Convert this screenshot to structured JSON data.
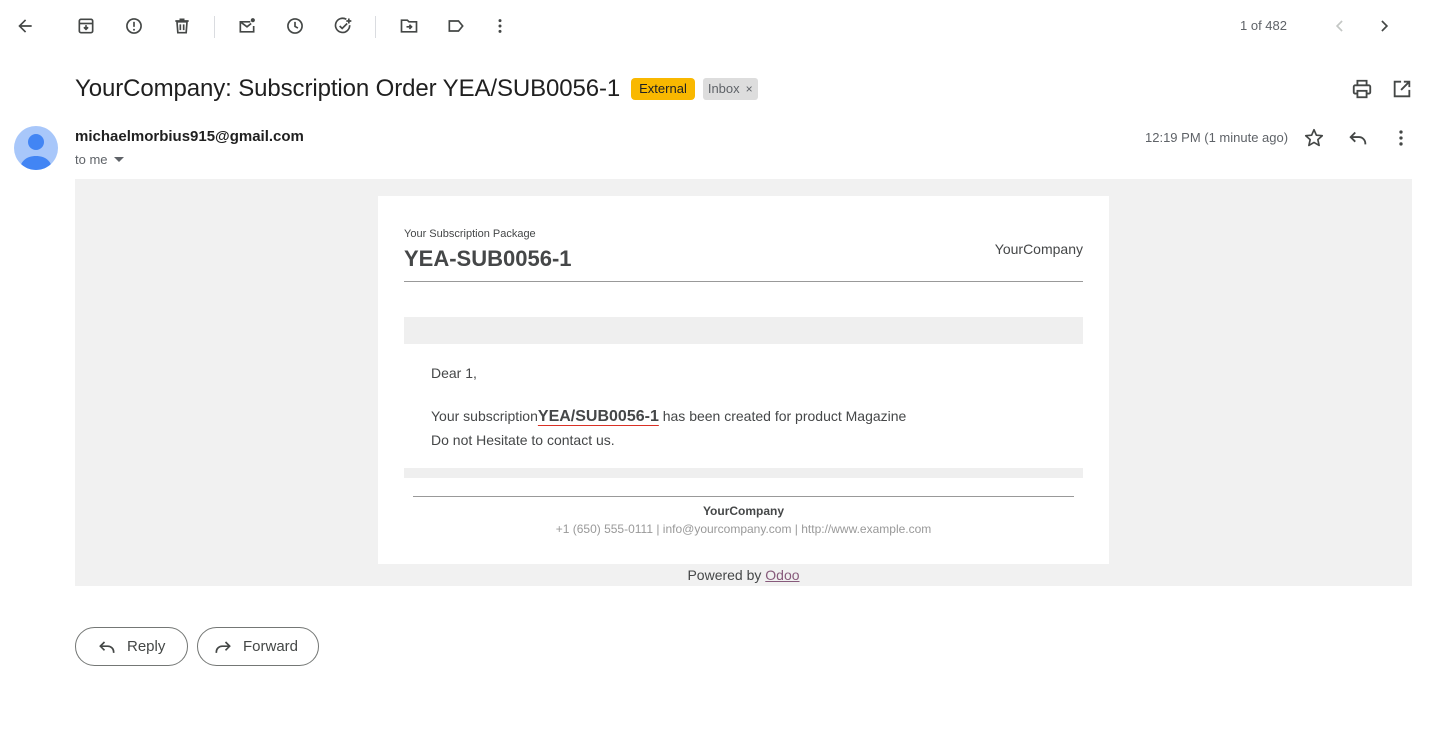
{
  "toolbar": {
    "icons": [
      "back-arrow-icon",
      "archive-icon",
      "report-spam-icon",
      "delete-icon",
      "mark-unread-icon",
      "snooze-icon",
      "add-task-icon",
      "move-to-icon",
      "label-icon",
      "more-vert-icon"
    ],
    "pager_text": "1 of 482"
  },
  "email": {
    "subject": "YourCompany: Subscription Order YEA/SUB0056-1",
    "labels": {
      "external": "External",
      "inbox": "Inbox",
      "inbox_remove": "×"
    },
    "sender": "michaelmorbius915@gmail.com",
    "recipient": "to me",
    "timestamp": "12:19 PM (1 minute ago)"
  },
  "message": {
    "package_label": "Your Subscription Package",
    "package_code": "YEA-SUB0056-1",
    "company": "YourCompany",
    "greeting": "Dear 1,",
    "body_prefix": "Your subscription",
    "subscription_code": "YEA/SUB0056-1",
    "body_suffix": " has been created for product Magazine",
    "body_line2": "Do not Hesitate to contact us.",
    "footer_company": "YourCompany",
    "footer_contact": "+1 (650) 555-0111 | info@yourcompany.com | http://www.example.com",
    "powered_by": "Powered by ",
    "powered_link": "Odoo"
  },
  "actions": {
    "reply": "Reply",
    "forward": "Forward"
  },
  "colors": {
    "external_badge": "#f9b800",
    "avatar": "#a8c7fa",
    "avatar_figure": "#4285f4",
    "odoo_link": "#875a7b"
  }
}
